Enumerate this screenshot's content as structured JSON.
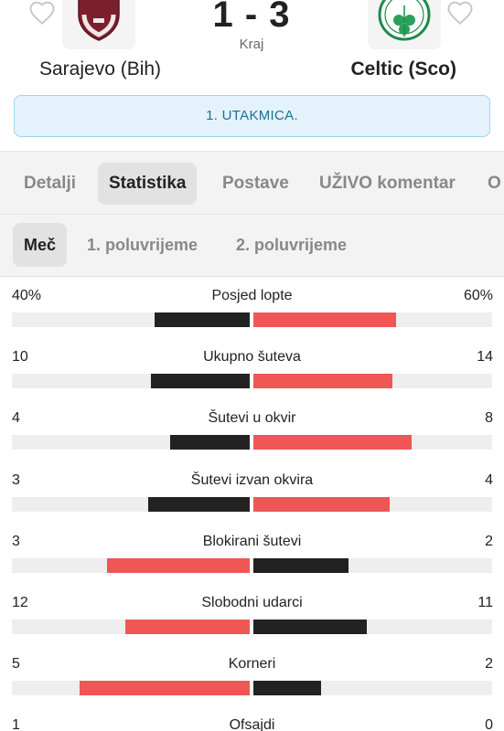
{
  "match": {
    "score": "1 - 3",
    "status": "Kraj",
    "home_team": "Sarajevo (Bih)",
    "away_team": "Celtic (Sco)",
    "leg": "1. UTAKMICA."
  },
  "tabs": [
    "Detalji",
    "Statistika",
    "Postave",
    "UŽIVO komentar",
    "O"
  ],
  "active_tab": "Statistika",
  "subtabs": [
    "Meč",
    "1. poluvrijeme",
    "2. poluvrijeme"
  ],
  "active_subtab": "Meč",
  "colors": {
    "leader": "#f05656",
    "trailer": "#222222",
    "accent": "#2e7d32"
  },
  "icons": {
    "favorite": "heart-outline-icon",
    "home_logo": "fk-sarajevo-crest-icon",
    "away_logo": "celtic-crest-icon"
  },
  "stats": [
    {
      "label": "Posjed lopte",
      "home": "40%",
      "away": "60%",
      "home_val": 40,
      "away_val": 60,
      "max": 100
    },
    {
      "label": "Ukupno šuteva",
      "home": "10",
      "away": "14",
      "home_val": 10,
      "away_val": 14,
      "max": 24
    },
    {
      "label": "Šutevi u okvir",
      "home": "4",
      "away": "8",
      "home_val": 4,
      "away_val": 8,
      "max": 12
    },
    {
      "label": "Šutevi izvan okvira",
      "home": "3",
      "away": "4",
      "home_val": 3,
      "away_val": 4,
      "max": 7
    },
    {
      "label": "Blokirani šutevi",
      "home": "3",
      "away": "2",
      "home_val": 3,
      "away_val": 2,
      "max": 5
    },
    {
      "label": "Slobodni udarci",
      "home": "12",
      "away": "11",
      "home_val": 12,
      "away_val": 11,
      "max": 23
    },
    {
      "label": "Korneri",
      "home": "5",
      "away": "2",
      "home_val": 5,
      "away_val": 2,
      "max": 7
    },
    {
      "label": "Ofsajdi",
      "home": "1",
      "away": "0",
      "home_val": 1,
      "away_val": 0,
      "max": 1
    }
  ]
}
